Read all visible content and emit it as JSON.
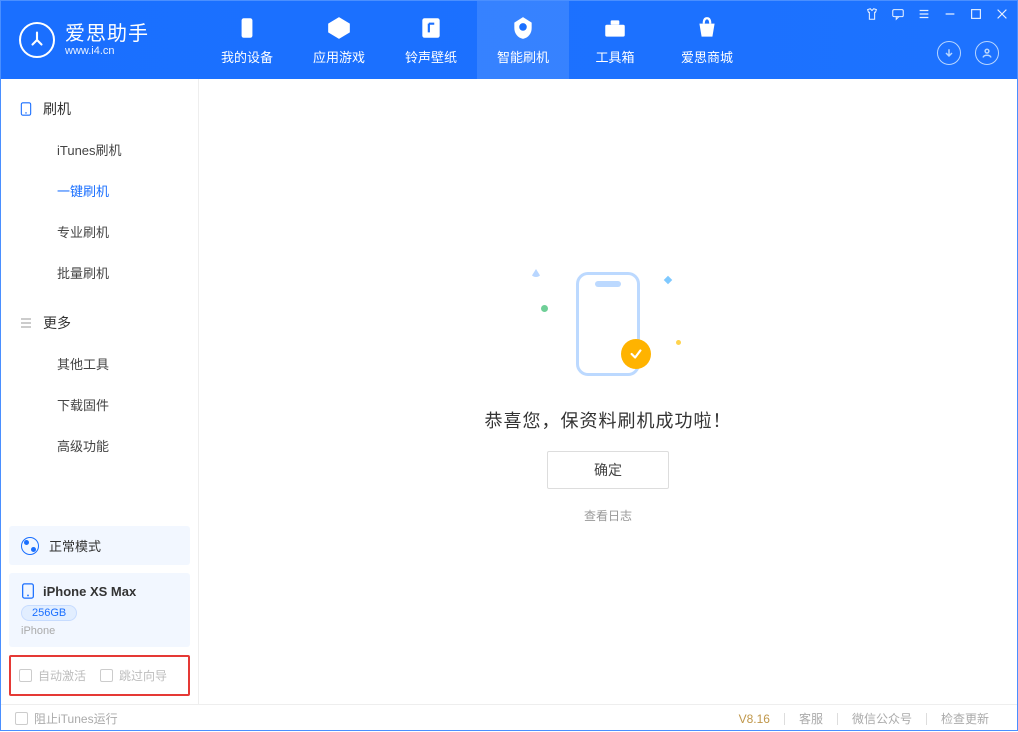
{
  "app": {
    "name": "爱思助手",
    "url": "www.i4.cn"
  },
  "nav": {
    "device": "我的设备",
    "apps": "应用游戏",
    "ring": "铃声壁纸",
    "flash": "智能刷机",
    "toolbox": "工具箱",
    "store": "爱思商城"
  },
  "sidebar": {
    "section1": {
      "title": "刷机",
      "items": [
        "iTunes刷机",
        "一键刷机",
        "专业刷机",
        "批量刷机"
      ]
    },
    "section2": {
      "title": "更多",
      "items": [
        "其他工具",
        "下载固件",
        "高级功能"
      ]
    },
    "mode": "正常模式",
    "device": {
      "name": "iPhone XS Max",
      "capacity": "256GB",
      "type": "iPhone"
    },
    "options": {
      "auto_activate": "自动激活",
      "skip_guide": "跳过向导"
    }
  },
  "main": {
    "success": "恭喜您，保资料刷机成功啦！",
    "ok": "确定",
    "log": "查看日志"
  },
  "footer": {
    "block_itunes": "阻止iTunes运行",
    "version": "V8.16",
    "support": "客服",
    "wechat": "微信公众号",
    "update": "检查更新"
  }
}
